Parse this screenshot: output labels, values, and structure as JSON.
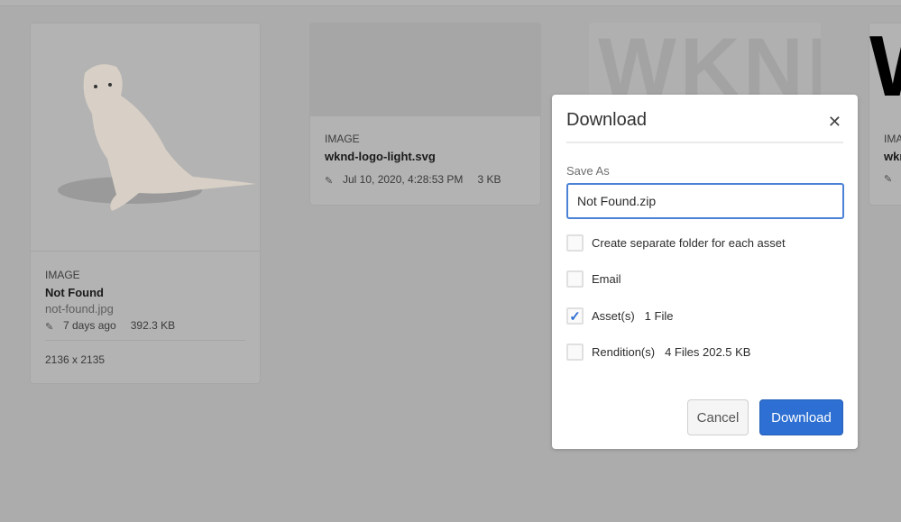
{
  "cards": [
    {
      "type": "IMAGE",
      "title": "Not Found",
      "filename": "not-found.jpg",
      "modified": "7 days ago",
      "size": "392.3 KB",
      "dimensions": "2136 x 2135"
    },
    {
      "type": "IMAGE",
      "title": "wknd-logo-light.svg",
      "modified": "Jul 10, 2020, 4:28:53 PM",
      "size": "3 KB"
    },
    {
      "thumb_text": "WKND"
    },
    {
      "type": "IMA",
      "title": "wkn",
      "thumb_text": "W"
    }
  ],
  "dialog": {
    "title": "Download",
    "close_icon": "close-icon",
    "save_as_label": "Save As",
    "save_as_value": "Not Found.zip",
    "options": [
      {
        "label": "Create separate folder for each asset",
        "checked": false,
        "extra": ""
      },
      {
        "label": "Email",
        "checked": false,
        "extra": ""
      },
      {
        "label": "Asset(s)",
        "checked": true,
        "extra": "1 File"
      },
      {
        "label": "Rendition(s)",
        "checked": false,
        "extra": "4 Files 202.5 KB"
      }
    ],
    "cancel_label": "Cancel",
    "download_label": "Download",
    "accent_color": "#2d6fd2"
  }
}
